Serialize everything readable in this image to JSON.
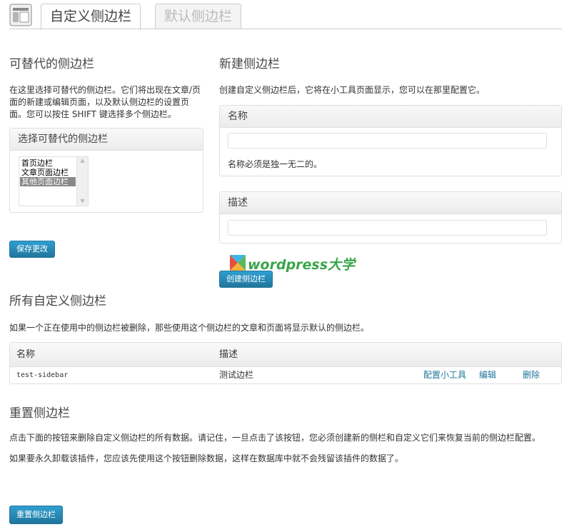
{
  "tabs": [
    {
      "label": "自定义侧边栏"
    },
    {
      "label": "默认侧边栏"
    }
  ],
  "replaceable": {
    "title": "可替代的侧边栏",
    "desc": "在这里选择可替代的侧边栏。它们将出现在文章/页面的新建或编辑页面，以及默认侧边栏的设置页面。您可以按住 SHIFT 键选择多个侧边栏。",
    "box_title": "选择可替代的侧边栏",
    "options": [
      "首页边栏",
      "文章页面边栏",
      "其他页面边栏"
    ],
    "save_label": "保存更改"
  },
  "new_sidebar": {
    "title": "新建侧边栏",
    "desc": "创建自定义侧边栏后，它将在小工具页面显示，您可以在那里配置它。",
    "name_label": "名称",
    "name_value": "",
    "name_hint": "名称必须是独一无二的。",
    "desc_label": "描述",
    "desc_value": "",
    "create_label": "创建侧边栏"
  },
  "watermark": {
    "text": "wordpress大学"
  },
  "all_sidebars": {
    "title": "所有自定义侧边栏",
    "desc": "如果一个正在使用中的侧边栏被删除，那些使用这个侧边栏的文章和页面将显示默认的侧边栏。",
    "columns": [
      "名称",
      "描述"
    ],
    "rows": [
      {
        "name": "test-sidebar",
        "description": "测试边栏",
        "configure": "配置小工具",
        "edit": "编辑",
        "delete": "删除"
      }
    ]
  },
  "reset": {
    "title": "重置侧边栏",
    "desc1": "点击下面的按钮来删除自定义侧边栏的所有数据。请记住，一旦点击了该按钮，您必须创建新的侧栏和自定义它们来恢复当前的侧边栏配置。",
    "desc2": "如果要永久卸载该插件，您应该先使用这个按钮删除数据，这样在数据库中就不会残留该插件的数据了。",
    "button_label": "重置侧边栏"
  }
}
